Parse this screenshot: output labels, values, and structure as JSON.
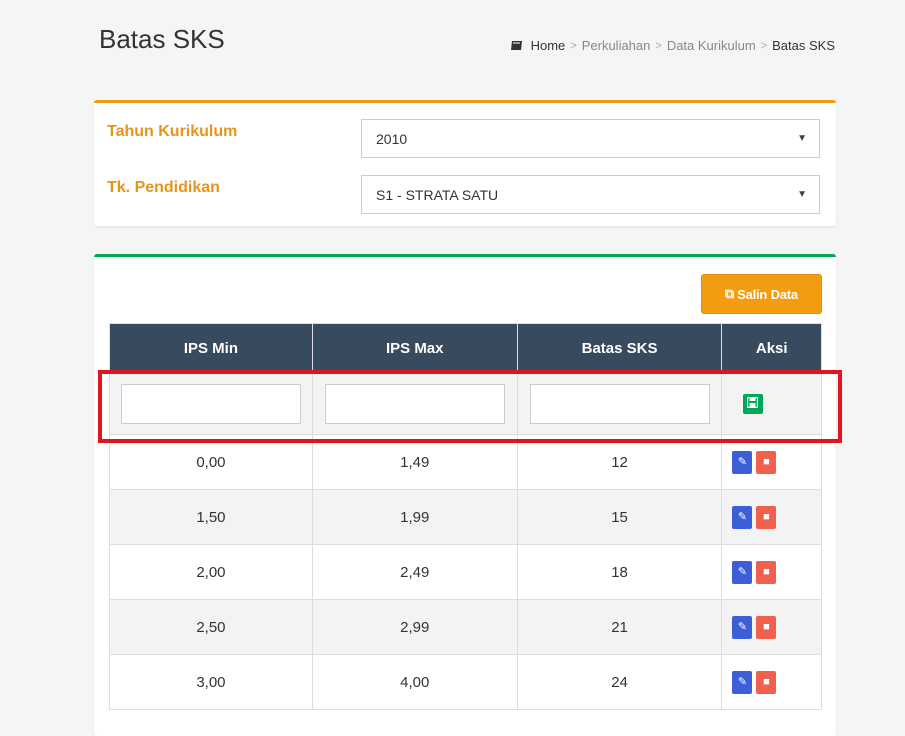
{
  "header": {
    "title": "Batas SKS",
    "breadcrumb": [
      "Home",
      "Perkuliahan",
      "Data Kurikulum",
      "Batas SKS"
    ],
    "separator": ">"
  },
  "filter": {
    "tahun_label": "Tahun Kurikulum",
    "tahun_value": "2010",
    "pendidikan_label": "Tk. Pendidikan",
    "pendidikan_value": "S1 - STRATA SATU",
    "accent": "#f39c12"
  },
  "toolbar": {
    "salin_label": "Salin Data"
  },
  "table": {
    "headers": [
      "IPS Min",
      "IPS Max",
      "Batas SKS",
      "Aksi"
    ],
    "rows": [
      [
        "0,00",
        "1,49",
        "12"
      ],
      [
        "1,50",
        "1,99",
        "15"
      ],
      [
        "2,00",
        "2,49",
        "18"
      ],
      [
        "2,50",
        "2,99",
        "21"
      ],
      [
        "3,00",
        "4,00",
        "24"
      ]
    ]
  },
  "colors": {
    "header_bg": "#374a5e",
    "save": "#00a65a",
    "edit": "#3c5fd8",
    "delete": "#f0614d",
    "highlight": "#e0161f"
  }
}
